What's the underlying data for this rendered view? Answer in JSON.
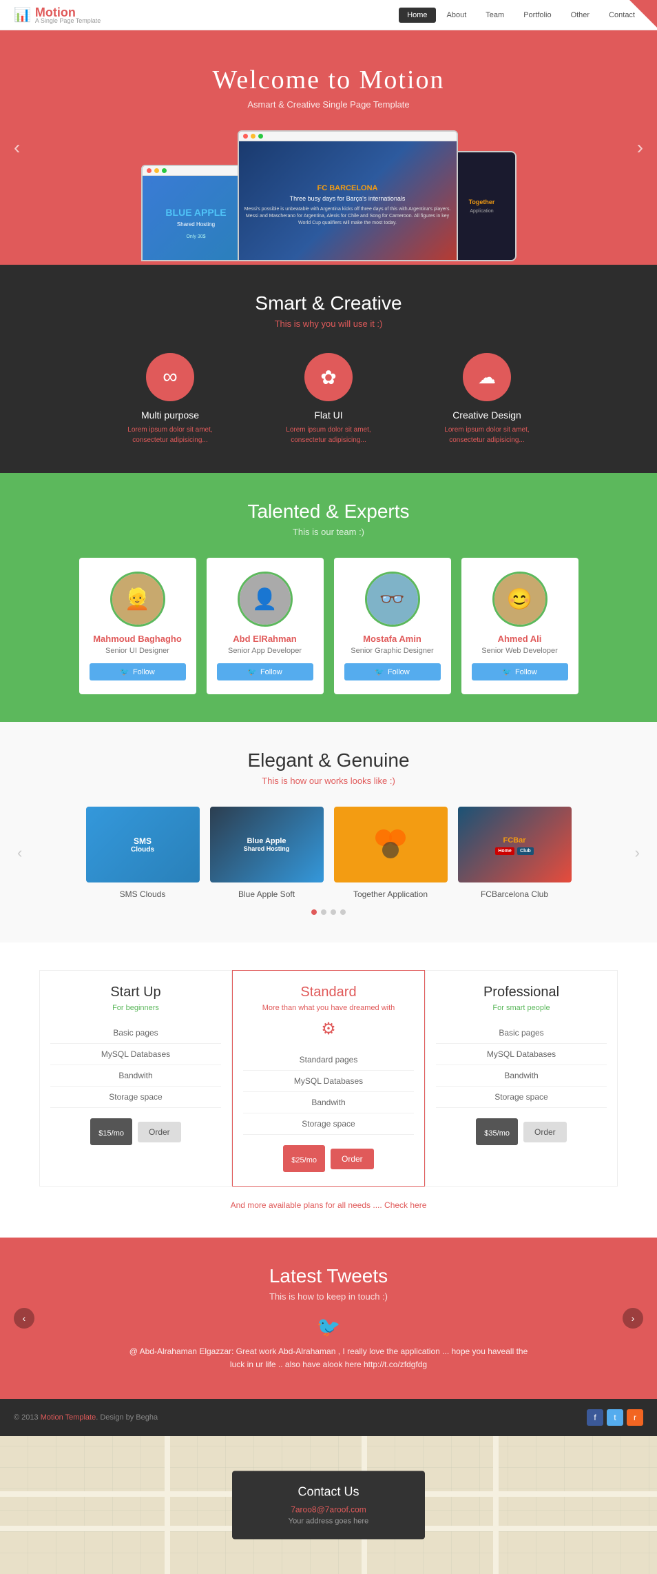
{
  "nav": {
    "logo_text": "Motion",
    "logo_sub": "A Single Page Template",
    "links": [
      {
        "label": "Home",
        "active": true
      },
      {
        "label": "About",
        "active": false
      },
      {
        "label": "Team",
        "active": false
      },
      {
        "label": "Portfolio",
        "active": false
      },
      {
        "label": "Other",
        "active": false
      },
      {
        "label": "Contact",
        "active": false
      }
    ]
  },
  "hero": {
    "title": "Welcome to Motion",
    "subtitle": "Asmart & Creative Single Page Template"
  },
  "smart": {
    "title": "Smart & Creative",
    "subtitle": "This is why you will use it :)",
    "features": [
      {
        "icon": "∞",
        "title": "Multi purpose",
        "desc": "Lorem ipsum dolor sit amet, consectetur adipisicing..."
      },
      {
        "icon": "✿",
        "title": "Flat UI",
        "desc": "Lorem ipsum dolor sit amet, consectetur adipisicing..."
      },
      {
        "icon": "☁",
        "title": "Creative Design",
        "desc": "Lorem ipsum dolor sit amet, consectetur adipisicing..."
      }
    ]
  },
  "team": {
    "title": "Talented & Experts",
    "subtitle": "This is our team :)",
    "members": [
      {
        "name": "Mahmoud Baghagho",
        "role": "Senior UI Designer",
        "avatar": "👤"
      },
      {
        "name": "Abd ElRahman",
        "role": "Senior App Developer",
        "avatar": "👤"
      },
      {
        "name": "Mostafa Amin",
        "role": "Senior Graphic Designer",
        "avatar": "👤"
      },
      {
        "name": "Ahmed Ali",
        "role": "Senior Web Developer",
        "avatar": "👤"
      }
    ],
    "follow_label": "Follow"
  },
  "portfolio": {
    "title": "Elegant & Genuine",
    "subtitle": "This is how our works looks like :)",
    "items": [
      {
        "name": "SMS Clouds"
      },
      {
        "name": "Blue Apple Soft"
      },
      {
        "name": "Together Application"
      },
      {
        "name": "FCBarcelona Club"
      }
    ]
  },
  "pricing": {
    "plans": [
      {
        "title": "Start Up",
        "subtitle": "For beginners",
        "subtitle_color": "green",
        "features": [
          "Basic pages",
          "MySQL Databases",
          "Bandwith",
          "Storage space"
        ],
        "price": "$15",
        "period": "/mo",
        "order": "Order",
        "featured": false
      },
      {
        "title": "Standard",
        "subtitle": "More than what you have dreamed with",
        "subtitle_color": "red",
        "features": [
          "Standard pages",
          "MySQL Databases",
          "Bandwith",
          "Storage space"
        ],
        "price": "$25",
        "period": "/mo",
        "order": "Order",
        "featured": true
      },
      {
        "title": "Professional",
        "subtitle": "For smart people",
        "subtitle_color": "green",
        "features": [
          "Basic pages",
          "MySQL Databases",
          "Bandwith",
          "Storage space"
        ],
        "price": "$35",
        "period": "/mo",
        "order": "Order",
        "featured": false
      }
    ],
    "more_plans": "And more available plans for all needs .... Check here"
  },
  "tweets": {
    "title": "Latest Tweets",
    "subtitle": "This is how to keep in touch :)",
    "tweet_text": "@ Abd-Alrahaman Elgazzar: Great work Abd-Alrahaman , I really love the application ... hope you haveall the luck in ur life .. also have alook here http://t.co/zfdgfdg"
  },
  "footer": {
    "text": "© 2013 Motion Template. Design by Begha",
    "social": [
      "f",
      "t",
      "r"
    ]
  },
  "contact": {
    "title": "Contact Us",
    "email": "7aroo8@7aroof.com",
    "address": "Your address goes here"
  }
}
